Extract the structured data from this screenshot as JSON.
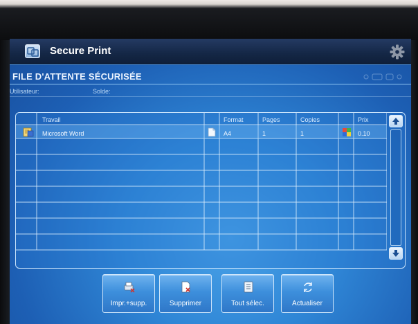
{
  "app": {
    "title": "Secure Print",
    "icon": "secure-print-icon",
    "settings_icon": "gear-icon"
  },
  "queue": {
    "title": "FILE D'ATTENTE SÉCURISÉE",
    "user_label": "Utilisateur:",
    "balance_label": "Solde:"
  },
  "table": {
    "columns": [
      "Travail",
      "Format",
      "Pages",
      "Copies",
      "Prix"
    ],
    "rows": [
      {
        "job": "Microsoft Word",
        "format": "A4",
        "pages": "1",
        "copies": "1",
        "price": "0.10",
        "icon": "word-document-icon",
        "file_icon": "file-icon",
        "color_icon": "color-print-icon"
      }
    ]
  },
  "buttons": {
    "print_delete": "Impr.+supp.",
    "delete": "Supprimer",
    "select_all": "Tout sélec.",
    "refresh": "Actualiser"
  },
  "colors": {
    "title_bar": "#152847",
    "screen": "#2f86d6",
    "accent": "#c9e3fb"
  }
}
